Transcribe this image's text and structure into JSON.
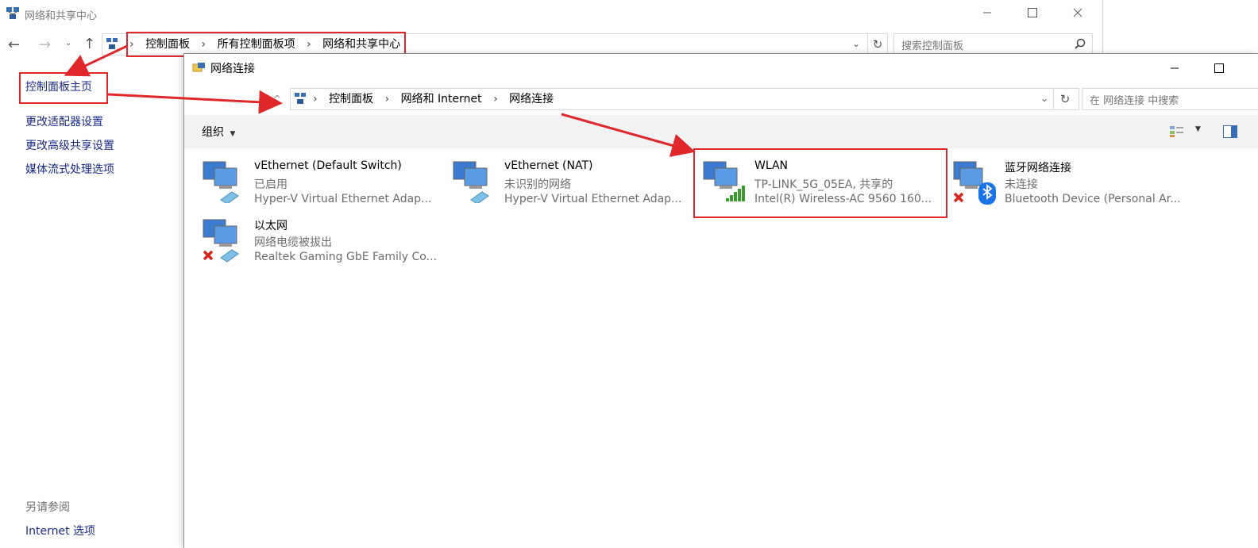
{
  "back_window": {
    "title": "网络和共享中心",
    "breadcrumb": [
      "控制面板",
      "所有控制面板项",
      "网络和共享中心"
    ],
    "search_placeholder": "搜索控制面板",
    "sidebar": {
      "home": "控制面板主页",
      "links": [
        "更改适配器设置",
        "更改高级共享设置",
        "媒体流式处理选项"
      ],
      "see_also_heading": "另请参阅",
      "see_also_links": [
        "Internet 选项"
      ]
    }
  },
  "front_window": {
    "title": "网络连接",
    "breadcrumb": [
      "控制面板",
      "网络和 Internet",
      "网络连接"
    ],
    "search_placeholder": "在 网络连接 中搜索",
    "toolbar": {
      "organize": "组织"
    },
    "connections": [
      {
        "name": "vEthernet (Default Switch)",
        "status": "已启用",
        "device": "Hyper-V Virtual Ethernet Adap...",
        "icon": "ethernet-adapter-icon"
      },
      {
        "name": "vEthernet (NAT)",
        "status": "未识别的网络",
        "device": "Hyper-V Virtual Ethernet Adap...",
        "icon": "ethernet-adapter-icon"
      },
      {
        "name": "WLAN",
        "status": "TP-LINK_5G_05EA, 共享的",
        "device": "Intel(R) Wireless-AC 9560 160...",
        "icon": "wifi-signal-icon"
      },
      {
        "name": "蓝牙网络连接",
        "status": "未连接",
        "device": "Bluetooth Device (Personal Ar...",
        "icon": "bluetooth-icon"
      },
      {
        "name": "以太网",
        "status": "网络电缆被拔出",
        "device": "Realtek Gaming GbE Family Co...",
        "icon": "ethernet-disconnected-icon"
      }
    ]
  },
  "colors": {
    "annotation_red": "#e0282c",
    "link_blue": "#1a2a8a"
  }
}
